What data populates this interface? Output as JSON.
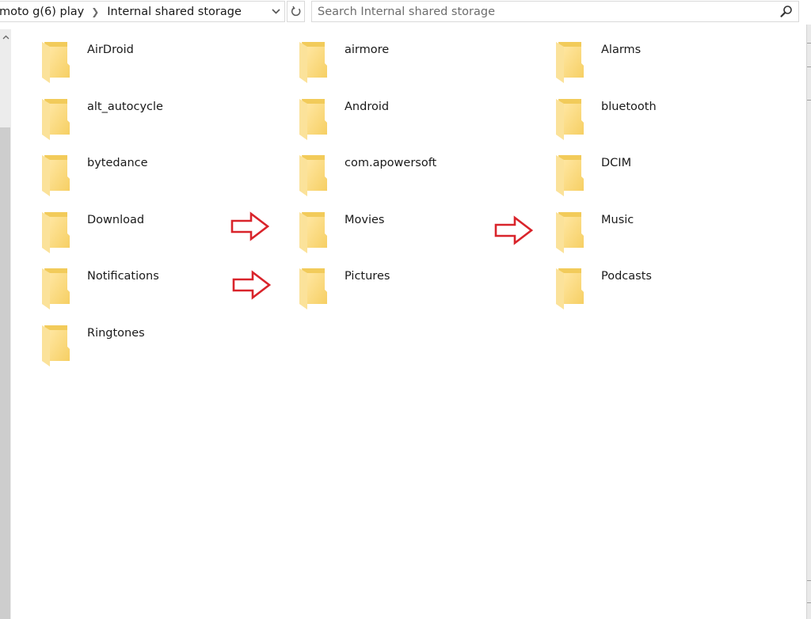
{
  "address_bar": {
    "breadcrumbs": [
      {
        "label": "moto g(6) play"
      },
      {
        "label": "Internal shared storage"
      }
    ],
    "separator_icon": "chevron-right-icon",
    "dropdown_icon": "chevron-down-icon",
    "refresh_icon": "refresh-icon"
  },
  "search": {
    "placeholder": "Search Internal shared storage",
    "value": "",
    "icon": "search-icon"
  },
  "folders": [
    {
      "name": "AirDroid"
    },
    {
      "name": "airmore"
    },
    {
      "name": "Alarms"
    },
    {
      "name": "alt_autocycle"
    },
    {
      "name": "Android"
    },
    {
      "name": "bluetooth"
    },
    {
      "name": "bytedance"
    },
    {
      "name": "com.apowersoft"
    },
    {
      "name": "DCIM"
    },
    {
      "name": "Download"
    },
    {
      "name": "Movies"
    },
    {
      "name": "Music"
    },
    {
      "name": "Notifications"
    },
    {
      "name": "Pictures"
    },
    {
      "name": "Podcasts"
    },
    {
      "name": "Ringtones"
    }
  ],
  "annotations": {
    "arrow_color": "#d9242b",
    "arrows": [
      {
        "points_to": "Movies"
      },
      {
        "points_to": "Pictures"
      },
      {
        "points_to": "Music"
      }
    ]
  },
  "colors": {
    "folder_back": "#f2c94c",
    "folder_front": "#ffe08a",
    "scroll_track": "#ececec",
    "scroll_thumb": "#cdcdcd",
    "border": "#d9d9d9"
  }
}
